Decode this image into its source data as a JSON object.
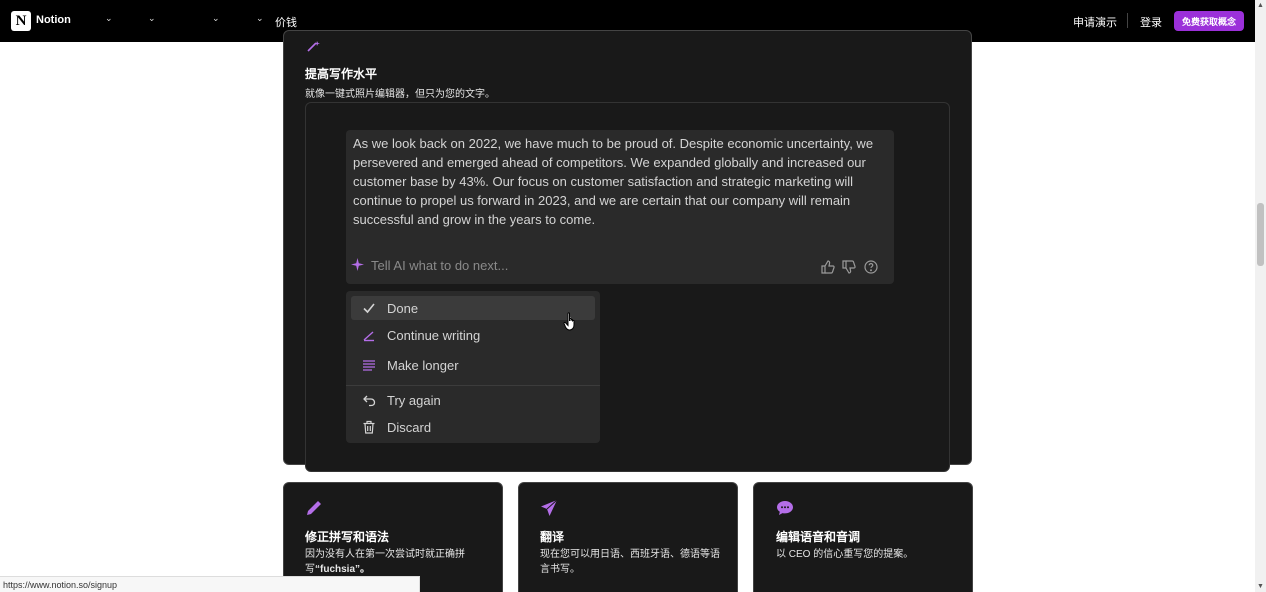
{
  "nav": {
    "logo_letter": "N",
    "brand": "Notion",
    "pricing": "价钱",
    "request_demo": "申请演示",
    "login": "登录",
    "cta": "免费获取概念"
  },
  "section": {
    "title": "提高写作水平",
    "subtitle": "就像一键式照片编辑器，但只为您的文字。"
  },
  "ai": {
    "response_text": "As we look back on 2022, we have much to be proud of. Despite economic uncertainty, we persevered and emerged ahead of competitors. We expanded globally and increased our customer base by 43%. Our focus on customer satisfaction and strategic marketing will continue to propel us forward in 2023, and we are certain that our company will remain successful and grow in the years to come.",
    "prompt_placeholder": "Tell AI what to do next...",
    "menu": [
      {
        "label": "Done",
        "icon": "check-icon"
      },
      {
        "label": "Continue writing",
        "icon": "pen-icon"
      },
      {
        "label": "Make longer",
        "icon": "lines-icon"
      },
      {
        "label": "Try again",
        "icon": "undo-icon"
      },
      {
        "label": "Discard",
        "icon": "trash-icon"
      }
    ]
  },
  "features": [
    {
      "title": "修正拼写和语法",
      "desc_a": "因为没有人在第一次尝试时就正确拼写",
      "desc_b": "“fuchsia”。"
    },
    {
      "title": "翻译",
      "desc_a": "现在您可以用日语、西班牙语、德语等语言书写。",
      "desc_b": ""
    },
    {
      "title": "编辑语音和音调",
      "desc_a": "以 CEO 的信心重写您的提案。",
      "desc_b": ""
    }
  ],
  "status_url": "https://www.notion.so/signup",
  "colors": {
    "accent": "#9b30d9",
    "icon_purple": "#b46ee8",
    "card_bg": "#191919"
  }
}
